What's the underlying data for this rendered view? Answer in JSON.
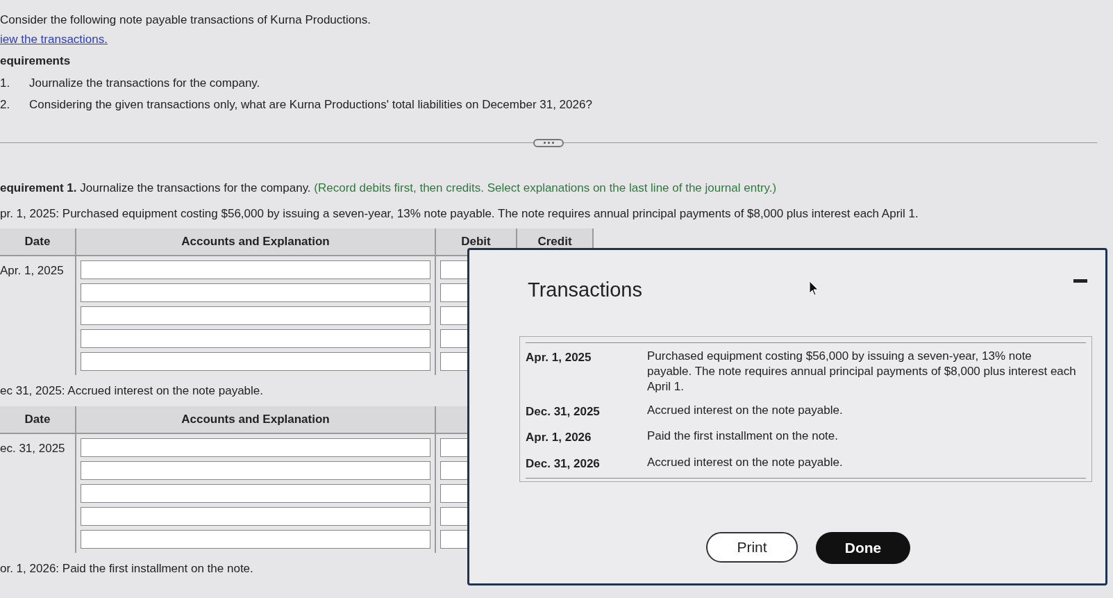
{
  "intro": "Consider the following note payable transactions of Kurna Productions.",
  "link": "iew the transactions.",
  "requirements_title": "equirements",
  "requirements": [
    {
      "number": "1.",
      "text": "Journalize the transactions for the company."
    },
    {
      "number": "2.",
      "text": "Considering the given transactions only, what are Kurna Productions' total liabilities on December 31, 2026?"
    }
  ],
  "requirement1": {
    "label": "equirement 1.",
    "text": "Journalize the transactions for the company.",
    "hint": "(Record debits first, then credits. Select explanations on the last line of the journal entry.)"
  },
  "entries": [
    {
      "description": "pr. 1, 2025: Purchased equipment costing $56,000 by issuing a seven-year, 13% note payable. The note requires annual principal payments of $8,000 plus interest each April 1.",
      "columns": [
        "Date",
        "Accounts and Explanation",
        "Debit",
        "Credit"
      ],
      "date": "Apr. 1, 2025"
    },
    {
      "description": "ec 31, 2025: Accrued interest on the note payable.",
      "columns": [
        "Date",
        "Accounts and Explanation"
      ],
      "date": "ec. 31, 2025"
    },
    {
      "description": "or. 1, 2026: Paid the first installment on the note."
    }
  ],
  "modal": {
    "title": "Transactions",
    "rows": [
      {
        "date": "Apr. 1, 2025",
        "text": "Purchased equipment costing $56,000 by issuing a seven-year, 13% note payable. The note requires annual principal payments of $8,000 plus interest each April 1."
      },
      {
        "date": "Dec. 31, 2025",
        "text": "Accrued interest on the note payable."
      },
      {
        "date": "Apr. 1, 2026",
        "text": "Paid the first installment on the note."
      },
      {
        "date": "Dec. 31, 2026",
        "text": "Accrued interest on the note payable."
      }
    ],
    "buttons": [
      {
        "label": "Print",
        "kind": "secondary"
      },
      {
        "label": "Done",
        "kind": "primary"
      }
    ]
  }
}
